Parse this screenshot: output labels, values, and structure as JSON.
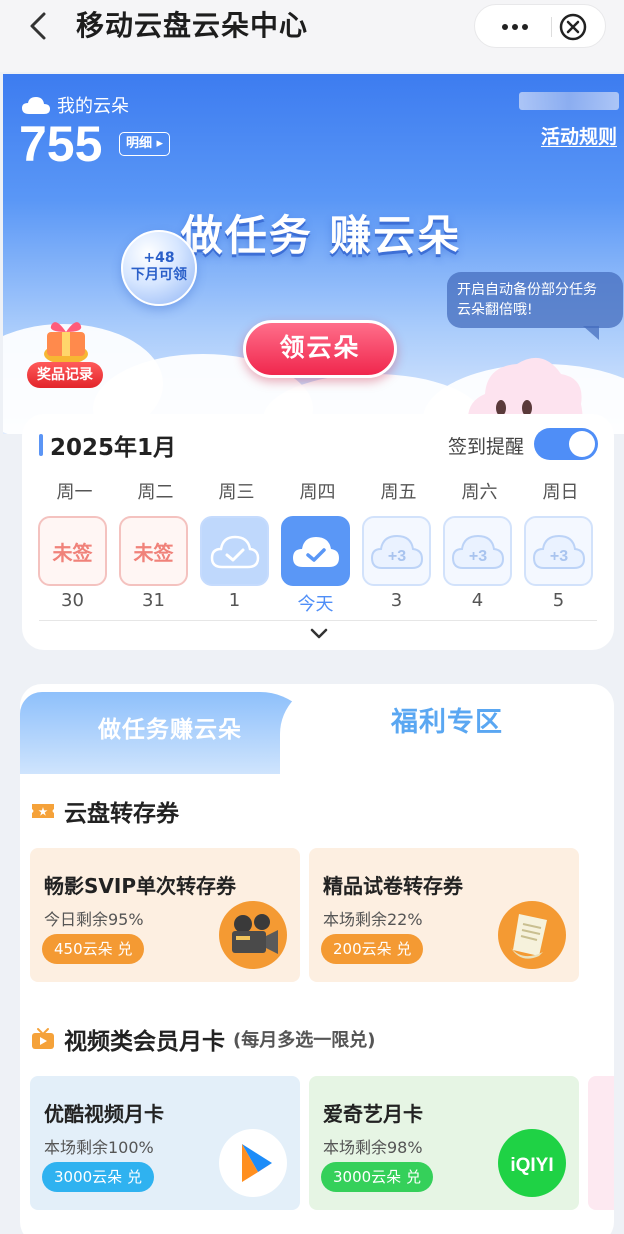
{
  "nav": {
    "title": "移动云盘云朵中心"
  },
  "hero": {
    "my_cloud_label": "我的云朵",
    "balance": "755",
    "detail_label": "明细",
    "rules_label": "活动规则",
    "slogan": "做任务 赚云朵",
    "bubble_amount": "+48",
    "bubble_caption": "下月可领",
    "speech": [
      "开启自动备份部分任务",
      "云朵翻倍哦!"
    ],
    "claim_button": "领云朵",
    "prize_label": "奖品记录"
  },
  "calendar": {
    "month": "2025年1月",
    "remind_label": "签到提醒",
    "remind_on": true,
    "weekdays": [
      "周一",
      "周二",
      "周三",
      "周四",
      "周五",
      "周六",
      "周日"
    ],
    "days": [
      {
        "status": "missed",
        "label": "未签",
        "date": "30"
      },
      {
        "status": "missed",
        "label": "未签",
        "date": "31"
      },
      {
        "status": "done",
        "label": "",
        "date": "1"
      },
      {
        "status": "today",
        "label": "",
        "date": "今天"
      },
      {
        "status": "future",
        "label": "+3",
        "date": "3"
      },
      {
        "status": "future",
        "label": "+3",
        "date": "4"
      },
      {
        "status": "future",
        "label": "+3",
        "date": "5"
      }
    ]
  },
  "tabs": {
    "left": "做任务赚云朵",
    "right": "福利专区"
  },
  "sections": {
    "transfer": {
      "title": "云盘转存券",
      "cards": [
        {
          "name": "畅影SVIP单次转存券",
          "remain": "今日剩余95%",
          "price": "450云朵 兑",
          "icon": "film-projector-icon"
        },
        {
          "name": "精品试卷转存券",
          "remain": "本场剩余22%",
          "price": "200云朵 兑",
          "icon": "exam-paper-icon"
        }
      ]
    },
    "video": {
      "title": "视频类会员月卡",
      "subtitle": "(每月多选一限兑)",
      "cards": [
        {
          "name": "优酷视频月卡",
          "remain": "本场剩余100%",
          "price": "3000云朵 兑",
          "icon": "youku-logo-icon"
        },
        {
          "name": "爱奇艺月卡",
          "remain": "本场剩余98%",
          "price": "3000云朵 兑",
          "icon": "iqiyi-logo-icon",
          "logo_text": "iQIYI"
        }
      ]
    }
  }
}
